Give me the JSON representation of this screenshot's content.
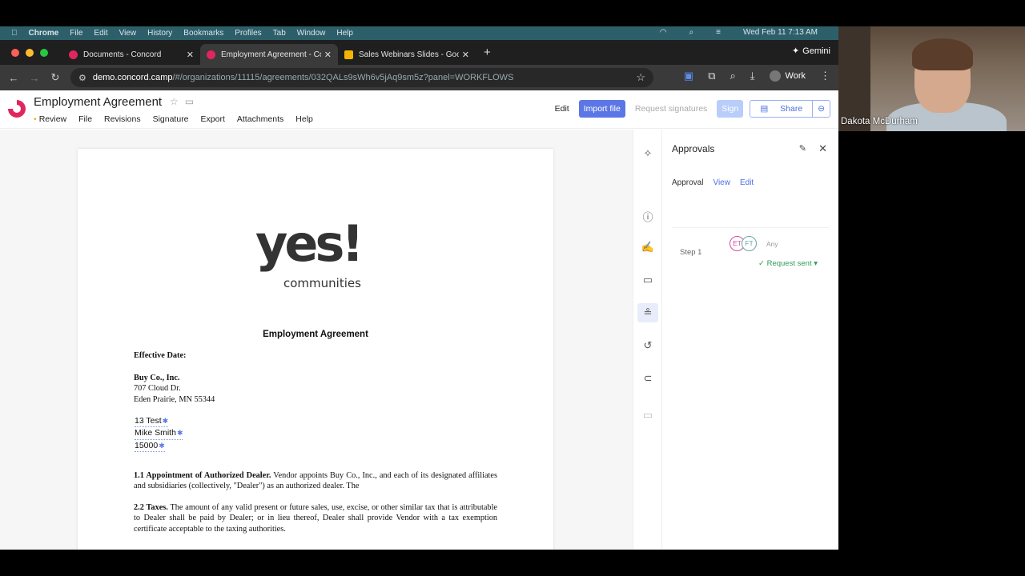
{
  "menubar": {
    "app": "Chrome",
    "items": [
      "File",
      "Edit",
      "View",
      "History",
      "Bookmarks",
      "Profiles",
      "Tab",
      "Window",
      "Help"
    ],
    "clock": "Wed Feb 11  7:13 AM"
  },
  "tabs": [
    {
      "title": "Documents - Concord",
      "favicon_color": "#e0265e"
    },
    {
      "title": "Employment Agreement - Co",
      "favicon_color": "#e0265e"
    },
    {
      "title": "Sales Webinars Slides - Goog",
      "favicon_color": "#f4b400"
    }
  ],
  "gemini_label": "Gemini",
  "address": {
    "host": "demo.concord.camp",
    "path": "/#/organizations/11115/agreements/032QALs9sWh6v5jAq9sm5z?panel=WORKFLOWS"
  },
  "profile_label": "Work",
  "app": {
    "doc_title": "Employment Agreement",
    "menu": [
      "Review",
      "File",
      "Revisions",
      "Signature",
      "Export",
      "Attachments",
      "Help"
    ],
    "buttons": {
      "edit": "Edit",
      "import": "Import file",
      "request": "Request signatures",
      "sign": "Sign",
      "share": "Share"
    }
  },
  "document": {
    "logo_main": "yes!",
    "logo_sub": "communities",
    "title": "Employment Agreement",
    "effective_date_label": "Effective Date:",
    "company": "Buy Co., Inc.",
    "address_line1": "707 Cloud Dr.",
    "address_line2": "Eden Prairie, MN 55344",
    "fields": [
      "13 Test",
      "Mike Smith",
      "15000"
    ],
    "section1_heading": "1.1 Appointment of Authorized Dealer.",
    "section1_text": " Vendor appoints Buy Co., Inc., and each of its designated affiliates and subsidiaries (collectively, \"Dealer\") as an authorized dealer. The",
    "section2_heading": "2.2 Taxes.",
    "section2_text": " The amount of any valid present or future sales, use, excise, or other similar tax that is attributable to Dealer shall be paid by Dealer; or in lieu thereof, Dealer shall provide Vendor with a tax exemption certificate acceptable to the taxing authorities."
  },
  "panel": {
    "title": "Approvals",
    "tabs": [
      "Approval",
      "View",
      "Edit"
    ],
    "step": {
      "name": "Step 1",
      "approvers": [
        "ET",
        "FT"
      ],
      "mode": "Any",
      "status": "✓ Request sent"
    }
  },
  "webcam": {
    "participant": "Dakota McDurham"
  }
}
